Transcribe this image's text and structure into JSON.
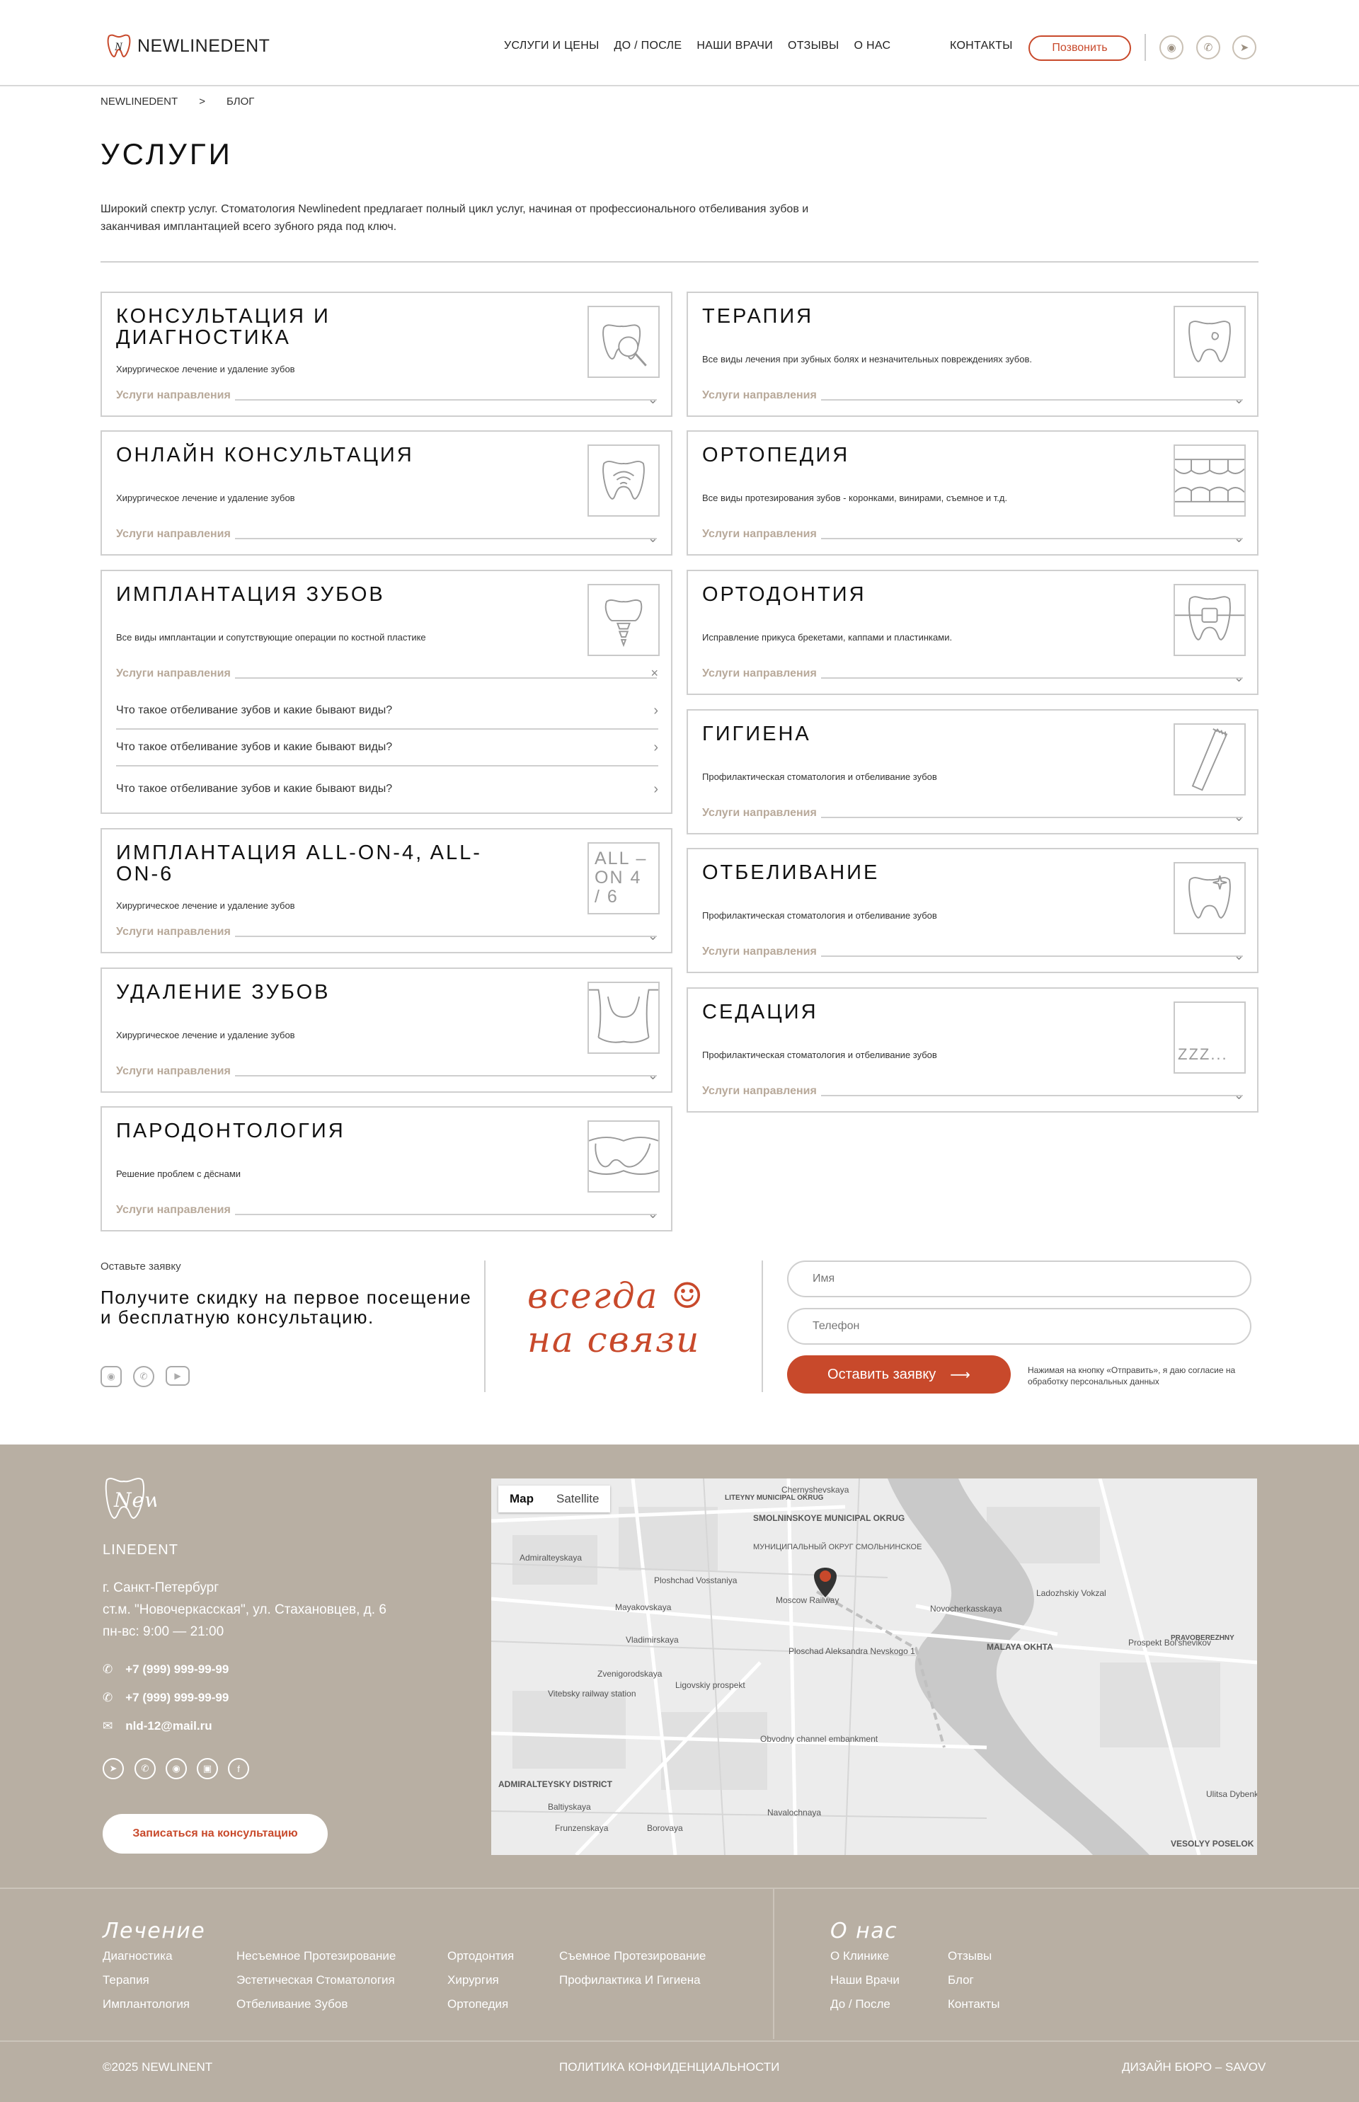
{
  "header": {
    "logo_text": "NEWLINEDENT",
    "nav": [
      "УСЛУГИ И ЦЕНЫ",
      "ДО / ПОСЛЕ",
      "НАШИ ВРАЧИ",
      "ОТЗЫВЫ",
      "О НАС"
    ],
    "contacts": "КОНТАКТЫ",
    "call_button": "Позвонить",
    "social_icons": [
      "instagram-icon",
      "whatsapp-icon",
      "telegram-icon"
    ]
  },
  "breadcrumb": [
    "NEWLINEDENT",
    ">",
    "БЛОГ"
  ],
  "page": {
    "title": "УСЛУГИ",
    "intro": "Широкий спектр услуг. Стоматология Newlinedent предлагает полный цикл услуг, начиная от профессионального отбеливания зубов и заканчивая имплантацией всего зубного ряда под ключ."
  },
  "dir_label": "Услуги направления",
  "left_cards": [
    {
      "title": "КОНСУЛЬТАЦИЯ И ДИАГНОСТИКА",
      "sub": "Хирургическое лечение и удаление зубов",
      "icon": "tooth-magnifier-icon"
    },
    {
      "title": "ОНЛАЙН КОНСУЛЬТАЦИЯ",
      "sub": "Хирургическое лечение и удаление зубов",
      "icon": "tooth-wifi-icon"
    },
    {
      "title": "ИМПЛАНТАЦИЯ ЗУБОВ",
      "sub": "Все виды имплантации и сопутствующие операции по костной пластике",
      "icon": "tooth-implant-icon"
    },
    {
      "title": "ИМПЛАНТАЦИЯ ALL-ON-4, ALL-ON-6",
      "sub": "Хирургическое лечение и удаление зубов",
      "icon_text": "ALL –ON 4 / 6"
    },
    {
      "title": "УДАЛЕНИЕ ЗУБОВ",
      "sub": "Хирургическое лечение и удаление зубов",
      "icon": "tooth-extraction-icon"
    },
    {
      "title": "ПАРОДОНТОЛОГИЯ",
      "sub": "Решение проблем с дёснами",
      "icon": "gums-icon"
    }
  ],
  "faq": [
    "Что такое отбеливание зубов и какие бывают виды?",
    "Что такое отбеливание зубов и какие бывают виды?",
    "Что такое отбеливание зубов и какие бывают виды?"
  ],
  "right_cards": [
    {
      "title": "ТЕРАПИЯ",
      "sub": "Все виды лечения при зубных болях и незначительных повреждениях зубов.",
      "icon": "tooth-caries-icon"
    },
    {
      "title": "ОРТОПЕДИЯ",
      "sub": "Все виды протезирования зубов - коронками, винирами, съемное и т.д.",
      "icon": "dentures-icon"
    },
    {
      "title": "ОРТОДОНТИЯ",
      "sub": "Исправление прикуса брекетами, каппами и пластинками.",
      "icon": "tooth-braces-icon"
    },
    {
      "title": "ГИГИЕНА",
      "sub": "Профилактическая стоматология и отбеливание зубов",
      "icon": "toothbrush-icon"
    },
    {
      "title": "ОТБЕЛИВАНИЕ",
      "sub": "Профилактическая стоматология и отбеливание зубов",
      "icon": "tooth-sparkle-icon"
    },
    {
      "title": "СЕДАЦИЯ",
      "sub": "Профилактическая стоматология и отбеливание зубов",
      "icon_text": "ZZZ..."
    }
  ],
  "lead": {
    "small": "Оставьте заявку",
    "big": "Получите скидку на первое посещение и бесплатную консультацию.",
    "script_line1": "всегда ☺",
    "script_line2": "на связи",
    "name_placeholder": "Имя",
    "phone_placeholder": "Телефон",
    "submit": "Оставить заявку",
    "consent": "Нажимая на кнопку «Отправить», я даю согласие на обработку персональных данных"
  },
  "footer": {
    "logo_text": "LINEDENT",
    "logo_script": "New",
    "address": [
      "г. Санкт-Петербург",
      "ст.м. \"Новочеркасская\", ул. Стахановцев, д. 6",
      "пн-вс: 9:00 — 21:00"
    ],
    "phone1": "+7 (999) 999-99-99",
    "phone2": "+7 (999) 999-99-99",
    "email": "nld-12@mail.ru",
    "book_button": "Записаться на консультацию",
    "map": {
      "tab_map": "Map",
      "tab_satellite": "Satellite",
      "labels": [
        "SMOLNINSKOYE MUNICIPAL OKRUG",
        "МУНИЦИПАЛЬНЫЙ ОКРУГ СМОЛЬНИНСКОЕ",
        "Moscow Railway",
        "Ploshchad Vosstaniya",
        "Mayakovskaya",
        "Vladimirskaya",
        "Ploschad Aleksandra Nevskogo 1",
        "Novocherkasskaya",
        "Ladozhskiy Vokzal",
        "MALAYA OKHTA",
        "Ligovskiy prospekt",
        "Zvenigorodskaya",
        "Obvodny channel embankment",
        "Prospekt Bol'shevikov",
        "Vitebsky railway station",
        "Admiralteyskaya",
        "ADMIRALTEYSKY DISTRICT",
        "Baltiyskaya",
        "Frunzenskaya",
        "Borovaya",
        "Navalochnaya",
        "VESOLYY POSELOK",
        "PRAVOBEREZHNY",
        "Chernyshevskaya",
        "LITEYNY MUNICIPAL OKRUG",
        "Ulitsa Dybenko"
      ]
    },
    "treatment_heading": "Лечение",
    "treatment_cols": [
      [
        "Диагностика",
        "Терапия",
        "Имплантология"
      ],
      [
        "Несъемное Протезирование",
        "Эстетическая Стоматология",
        "Отбеливание Зубов"
      ],
      [
        "Ортодонтия",
        "Хирургия",
        "Ортопедия"
      ],
      [
        "Съемное Протезирование",
        "Профилактика И Гигиена"
      ]
    ],
    "about_heading": "О нас",
    "about_cols": [
      [
        "О Клинике",
        "Наши Врачи",
        "До / После"
      ],
      [
        "Отзывы",
        "Блог",
        "Контакты"
      ]
    ],
    "copyright": "©2025 NEWLINENT",
    "privacy": "ПОЛИТИКА КОНФИДЕНЦИАЛЬНОСТИ",
    "design": "ДИЗАЙН БЮРО – SAVOV"
  },
  "colors": {
    "accent": "#c8492b",
    "footer_bg": "#b8afa3",
    "muted": "#b8a99a"
  }
}
